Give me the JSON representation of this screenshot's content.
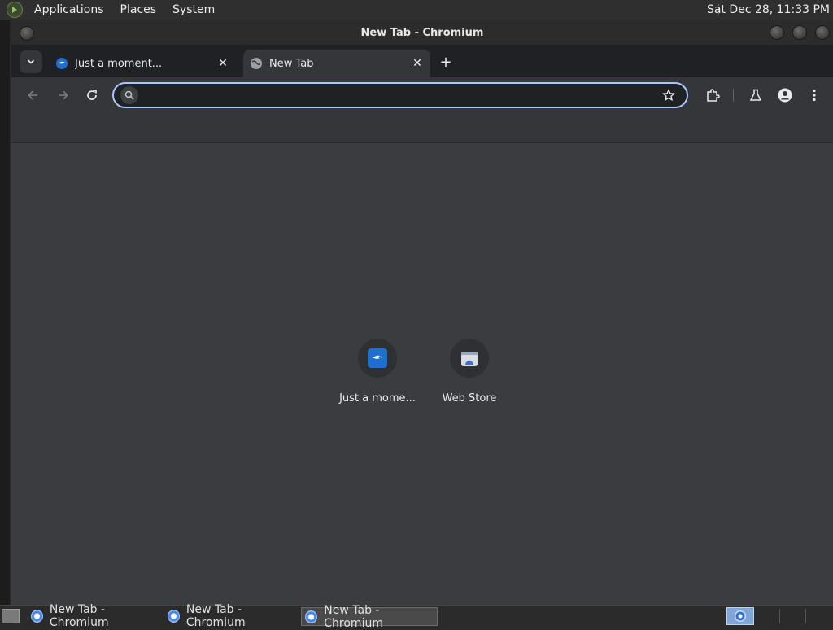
{
  "top_panel": {
    "menus": [
      "Applications",
      "Places",
      "System"
    ],
    "clock": "Sat Dec 28, 11:33 PM"
  },
  "window": {
    "title": "New Tab - Chromium"
  },
  "tabs": [
    {
      "title": "Just a moment...",
      "active": false
    },
    {
      "title": "New Tab",
      "active": true
    }
  ],
  "omnibox": {
    "value": "",
    "placeholder": ""
  },
  "shortcuts": [
    {
      "label": "Just a mome...",
      "icon": "site-favicon-icon"
    },
    {
      "label": "Web Store",
      "icon": "web-store-icon"
    }
  ],
  "taskbar": {
    "items": [
      "New Tab - Chromium",
      "New Tab - Chromium",
      "New Tab - Chromium"
    ]
  },
  "colors": {
    "accent": "#a8c7fa",
    "tab_strip": "#202124",
    "toolbar": "#35363a",
    "ntp_background": "#3b3c40"
  }
}
